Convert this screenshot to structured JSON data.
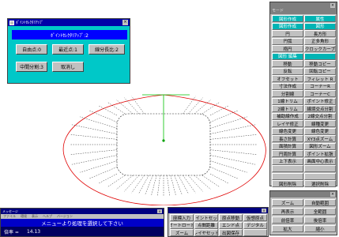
{
  "canvas": {
    "background": "#ffffff",
    "accent_red": "#e00000",
    "accent_green": "#00c000",
    "accent_blue": "#0000ff"
  },
  "snap_dialog": {
    "title": "ﾎﾟｲﾝﾄｾﾚｸﾀﾘｱｯﾌﾟ",
    "mode_display": "ﾎﾟｲﾝﾄｾﾚｸﾀﾘｱｯﾌﾟ:2",
    "buttons": {
      "free_point": "自由点:0",
      "nearest_point": "最近点:1",
      "line_length_ratio": "線分長比:2",
      "midpoint_division": "中間分割:3",
      "cancel": "取消し"
    }
  },
  "palette": {
    "subtitle": "モード",
    "buttons": [
      [
        "図形作成",
        "属性"
      ],
      [
        "図形作成",
        "図形"
      ],
      [
        "円",
        "長方形"
      ],
      [
        "円弧",
        "正多角形"
      ],
      [
        "楕円",
        "クロックカーブ"
      ],
      [
        "図形 編集",
        ""
      ],
      [
        "移動",
        "移動コピー"
      ],
      [
        "反転",
        "回転コピー"
      ],
      [
        "オフセット",
        "フィレット R"
      ],
      [
        "寸法作成",
        "コーナーR"
      ],
      [
        "分割線",
        "コーナーC"
      ],
      [
        "1線トリム",
        "ポイント修正"
      ],
      [
        "2線トリム",
        "線境交点分割"
      ],
      [
        "補助線作成",
        "2線交点分割"
      ],
      [
        "レイヤ修正",
        "線種変更"
      ],
      [
        "線色変更",
        "線色変更"
      ],
      [
        "長さ計算",
        "XY3点ズーム"
      ],
      [
        "面積計算",
        "図形ズーム"
      ],
      [
        "円周計算",
        "ポイント拡張"
      ],
      [
        "上下表示",
        "画面中心表示"
      ],
      [
        "",
        ""
      ],
      [
        "",
        ""
      ],
      [
        "図形削除",
        "選択削除"
      ]
    ]
  },
  "palette2": {
    "buttons": [
      [
        "ズーム",
        "自動範囲"
      ],
      [
        "再表示",
        "全範囲"
      ],
      [
        "前倍率",
        "後倍率"
      ],
      [
        "拡大",
        "縮小"
      ]
    ]
  },
  "cmdpal": {
    "buttons": [
      [
        "座標入力",
        "ポイントセット",
        "原点移動",
        "仮想原点"
      ],
      [
        "オートロード",
        "点間距離",
        "エンド点",
        "デジタル"
      ],
      [
        "ズーム",
        "レイヤセット",
        "出図保存",
        ""
      ]
    ]
  },
  "msgwin": {
    "title": "メッセージ",
    "menu": [
      "ファイル",
      "環境",
      "表示",
      "ヘルプ",
      "バージョン"
    ],
    "message": "メニューより処理を選択して下さい",
    "status_label": "倍率 =",
    "status_value": "14.13"
  }
}
